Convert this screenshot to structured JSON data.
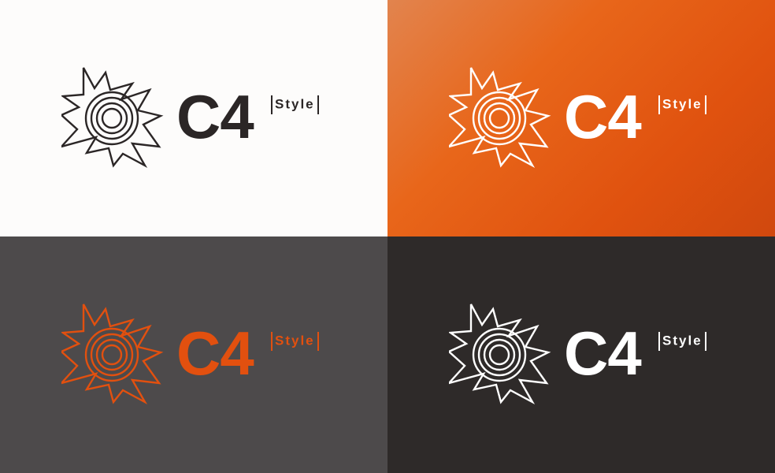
{
  "variants": [
    {
      "brand": "C4",
      "tagline": "Style",
      "background": "#fdfcfb",
      "mark_color": "#2b2626",
      "text_color": "#2b2626"
    },
    {
      "brand": "C4",
      "tagline": "Style",
      "background": "#e8661a",
      "mark_color": "#ffffff",
      "text_color": "#ffffff"
    },
    {
      "brand": "C4",
      "tagline": "Style",
      "background": "#4d4a4b",
      "mark_color": "#e2500f",
      "text_color": "#e2500f"
    },
    {
      "brand": "C4",
      "tagline": "Style",
      "background": "#2e2a29",
      "mark_color": "#ffffff",
      "text_color": "#ffffff"
    }
  ],
  "icons": {
    "mark": "sun-burst-icon"
  }
}
